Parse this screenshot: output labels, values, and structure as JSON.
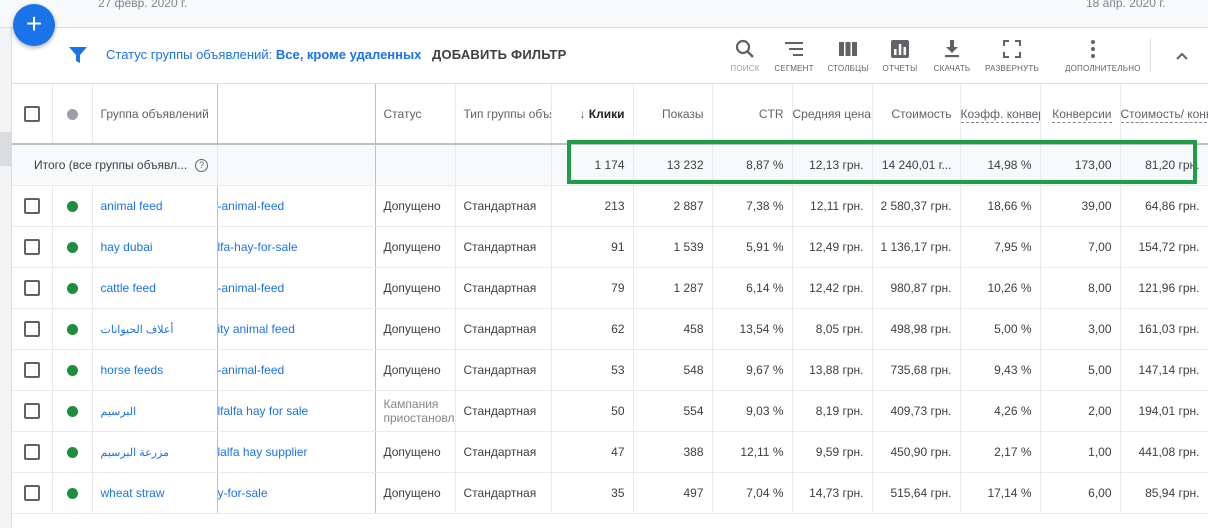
{
  "dates": {
    "start": "27 февр. 2020 г.",
    "end": "18 апр. 2020 г."
  },
  "fab": {
    "label": "+"
  },
  "filter": {
    "prefix": "Статус группы объявлений:",
    "value": "Все, кроме удаленных",
    "add": "ДОБАВИТЬ ФИЛЬТР"
  },
  "tools": [
    {
      "name": "search",
      "label": "ПОИСК",
      "icon": "search-icon"
    },
    {
      "name": "segment",
      "label": "СЕГМЕНТ",
      "icon": "segment-icon"
    },
    {
      "name": "columns",
      "label": "СТОЛБЦЫ",
      "icon": "columns-icon"
    },
    {
      "name": "reports",
      "label": "ОТЧЕТЫ",
      "icon": "reports-icon"
    },
    {
      "name": "download",
      "label": "СКАЧАТЬ",
      "icon": "download-icon"
    },
    {
      "name": "expand",
      "label": "РАЗВЕРНУТЬ",
      "icon": "expand-icon"
    },
    {
      "name": "more",
      "label": "ДОПОЛНИТЕЛЬНО",
      "icon": "more-vert-icon"
    }
  ],
  "columns": {
    "adgroup": "Группа объявлений",
    "status": "Статус",
    "type": "Тип группы объявлений",
    "clicks": "Клики",
    "impressions": "Показы",
    "ctr": "CTR",
    "avg_cpc": "Средняя цена за клик",
    "cost": "Стоимость",
    "conv_rate": "Коэфф. конверсии",
    "conversions": "Конверсии",
    "cost_per_conv": "Стоимость/ конв"
  },
  "total": {
    "label": "Итого (все группы объявл...",
    "clicks": "1 174",
    "impressions": "13 232",
    "ctr": "8,87 %",
    "avg_cpc": "12,13 грн.",
    "cost": "14 240,01 г...",
    "conv_rate": "14,98 %",
    "conversions": "173,00",
    "cost_per_conv": "81,20 грн."
  },
  "rows": [
    {
      "name": "animal feed",
      "campaign": "-animal-feed",
      "status": "Допущено",
      "type": "Стандартная",
      "clicks": "213",
      "impressions": "2 887",
      "ctr": "7,38 %",
      "avg_cpc": "12,11 грн.",
      "cost": "2 580,37 грн.",
      "conv_rate": "18,66 %",
      "conversions": "39,00",
      "cost_per_conv": "64,86 грн."
    },
    {
      "name": "hay dubai",
      "campaign": "lfa-hay-for-sale",
      "status": "Допущено",
      "type": "Стандартная",
      "clicks": "91",
      "impressions": "1 539",
      "ctr": "5,91 %",
      "avg_cpc": "12,49 грн.",
      "cost": "1 136,17 грн.",
      "conv_rate": "7,95 %",
      "conversions": "7,00",
      "cost_per_conv": "154,72 грн."
    },
    {
      "name": "cattle feed",
      "campaign": "-animal-feed",
      "status": "Допущено",
      "type": "Стандартная",
      "clicks": "79",
      "impressions": "1 287",
      "ctr": "6,14 %",
      "avg_cpc": "12,42 грн.",
      "cost": "980,87 грн.",
      "conv_rate": "10,26 %",
      "conversions": "8,00",
      "cost_per_conv": "121,96 грн."
    },
    {
      "name": "أعلاف الحيوانات",
      "campaign": "ity animal feed",
      "status": "Допущено",
      "type": "Стандартная",
      "clicks": "62",
      "impressions": "458",
      "ctr": "13,54 %",
      "avg_cpc": "8,05 грн.",
      "cost": "498,98 грн.",
      "conv_rate": "5,00 %",
      "conversions": "3,00",
      "cost_per_conv": "161,03 грн."
    },
    {
      "name": "horse feeds",
      "campaign": "-animal-feed",
      "status": "Допущено",
      "type": "Стандартная",
      "clicks": "53",
      "impressions": "548",
      "ctr": "9,67 %",
      "avg_cpc": "13,88 грн.",
      "cost": "735,68 грн.",
      "conv_rate": "9,43 %",
      "conversions": "5,00",
      "cost_per_conv": "147,14 грн."
    },
    {
      "name": "البرسيم",
      "campaign": "lfalfa hay for sale",
      "status": "Кампания приостановл",
      "type": "Стандартная",
      "clicks": "50",
      "impressions": "554",
      "ctr": "9,03 %",
      "avg_cpc": "8,19 грн.",
      "cost": "409,73 грн.",
      "conv_rate": "4,26 %",
      "conversions": "2,00",
      "cost_per_conv": "194,01 грн."
    },
    {
      "name": "مزرعة البرسيم",
      "campaign": "lalfa hay supplier",
      "status": "Допущено",
      "type": "Стандартная",
      "clicks": "47",
      "impressions": "388",
      "ctr": "12,11 %",
      "avg_cpc": "9,59 грн.",
      "cost": "450,90 грн.",
      "conv_rate": "2,17 %",
      "conversions": "1,00",
      "cost_per_conv": "441,08 грн."
    },
    {
      "name": "wheat straw",
      "campaign": "y-for-sale",
      "status": "Допущено",
      "type": "Стандартная",
      "clicks": "35",
      "impressions": "497",
      "ctr": "7,04 %",
      "avg_cpc": "14,73 грн.",
      "cost": "515,64 грн.",
      "conv_rate": "17,14 %",
      "conversions": "6,00",
      "cost_per_conv": "85,94 грн."
    }
  ],
  "colors": {
    "accent": "#1a73e8",
    "active": "#1e8e3e",
    "highlight": "#1e9e47"
  }
}
